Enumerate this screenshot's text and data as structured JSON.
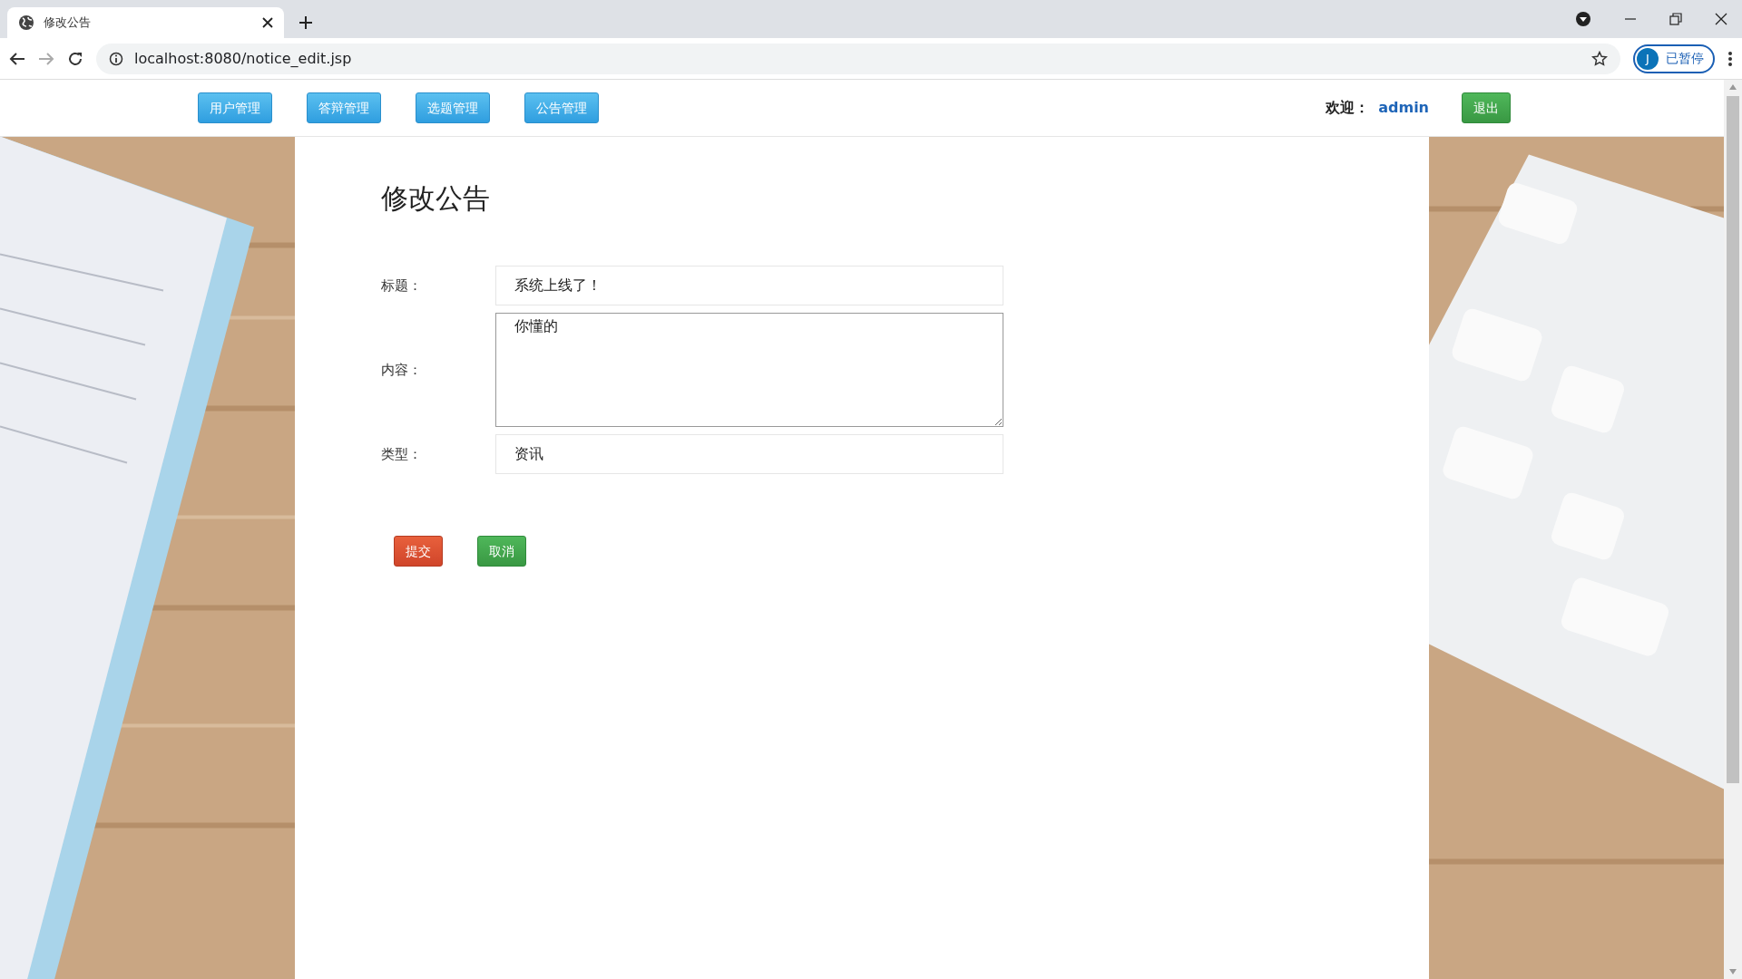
{
  "browser": {
    "tab_title": "修改公告",
    "url": "localhost:8080/notice_edit.jsp",
    "profile_initial": "J",
    "profile_label": "已暂停"
  },
  "nav": {
    "buttons": [
      "用户管理",
      "答辩管理",
      "选题管理",
      "公告管理"
    ],
    "welcome_label": "欢迎：",
    "user": "admin",
    "logout": "退出"
  },
  "form": {
    "heading": "修改公告",
    "fields": [
      {
        "label": "标题：",
        "kind": "input",
        "value": "系统上线了！"
      },
      {
        "label": "内容：",
        "kind": "textarea",
        "value": "你懂的"
      },
      {
        "label": "类型：",
        "kind": "input",
        "value": "资讯"
      }
    ],
    "buttons": [
      {
        "label": "提交",
        "kind": "danger"
      },
      {
        "label": "取消",
        "kind": "success"
      }
    ]
  }
}
